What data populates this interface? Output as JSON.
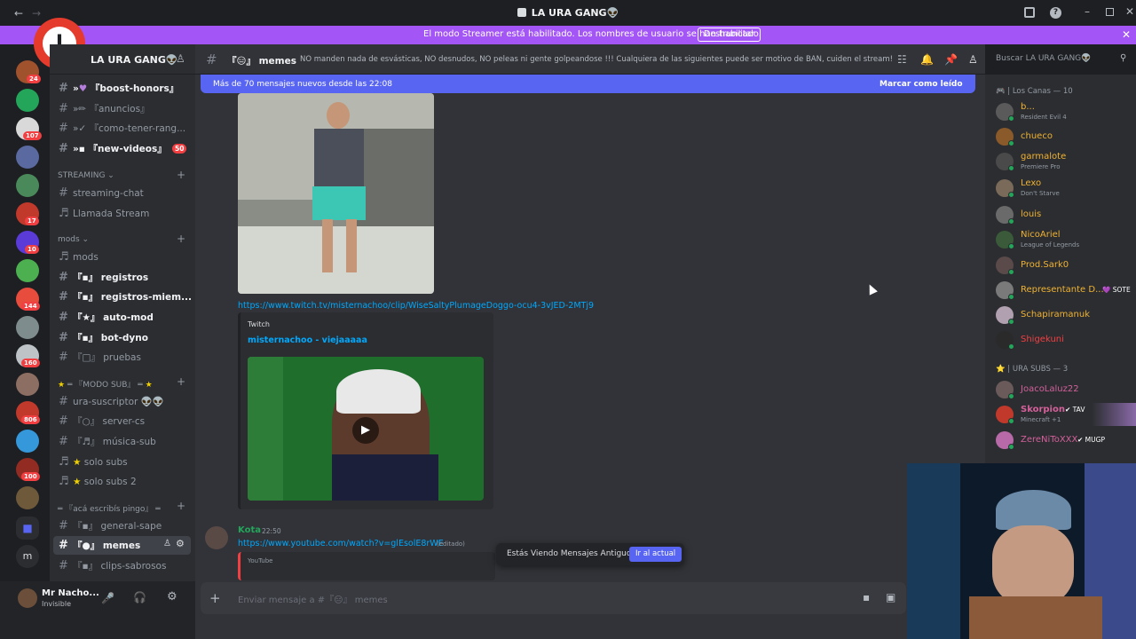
{
  "window": {
    "title": "LA URA GANG👽"
  },
  "streamer_bar": {
    "message": "El modo Streamer está habilitado. Los nombres de usuario se han truncado.",
    "button": "Deshabilitar"
  },
  "server": {
    "name": "LA URA GANG👽",
    "badges": [
      "24",
      "107",
      "17",
      "10",
      "144",
      "160",
      "806",
      "100"
    ]
  },
  "channels": {
    "top": [
      "『boost-honors』",
      "『anuncios』",
      "『como-tener-rang...",
      "『new-videos』"
    ],
    "new_videos_badge": "50",
    "streaming_cat": "STREAMING",
    "streaming": [
      "streaming-chat",
      "Llamada Stream"
    ],
    "mods_cat": "mods",
    "mods": [
      "mods",
      "registros",
      "registros-miem...",
      "auto-mod",
      "bot-dyno",
      "pruebas"
    ],
    "modo_sub_cat": "═ 『MODO SUB』 ═",
    "modo_sub": [
      "ura-suscriptor 👽👽",
      "server-cs",
      "música-sub",
      "solo subs",
      "solo subs 2"
    ],
    "escribis_cat": "═ 『acá escribís pingo』 ═",
    "escribis": [
      "general-sape",
      "memes",
      "clips-sabrosos"
    ]
  },
  "user": {
    "name": "Mr Nacho...",
    "status": "Invisible"
  },
  "header": {
    "channel": "『😑』 memes",
    "topic": "NO manden nada de esvásticas, NO desnudos, NO peleas ni gente golpeandose !!! Cualquiera de las siguientes puede ser motivo de BAN, cuiden el stream!",
    "search_placeholder": "Buscar LA URA GANG👽"
  },
  "new_messages": {
    "text": "Más de 70 mensajes nuevos desde las 22:08",
    "mark": "Marcar como leído"
  },
  "messages": {
    "link1": "https://www.twitch.tv/misternachoo/clip/WiseSaltyPlumageDoggo-ocu4-3vJED-2MTj9",
    "embed_provider": "Twitch",
    "embed_title": "misternachoo - viejaaaaa",
    "author2": "Kota",
    "time2": "22:50",
    "link2": "https://www.youtube.com/watch?v=glEsolE8rWE",
    "edited": "(editado)",
    "embed2_provider": "YouTube"
  },
  "old_messages": {
    "text": "Estás Viendo Mensajes Antiguos",
    "button": "Ir al actual"
  },
  "composer": {
    "placeholder": "Enviar mensaje a #『😑』 memes"
  },
  "members": {
    "group1": "🎮 | Los Canas — 10",
    "list1": [
      {
        "name": "b...",
        "activity": "Resident Evil 4",
        "color": "#f2f3f5"
      },
      {
        "name": "chueco",
        "activity": "",
        "color": "#f0b232"
      },
      {
        "name": "garmalote",
        "activity": "Premiere Pro",
        "color": "#f0b232"
      },
      {
        "name": "Lexo",
        "activity": "Don't Starve",
        "color": "#f0b232"
      },
      {
        "name": "louis",
        "activity": "",
        "color": "#f0b232"
      },
      {
        "name": "NicoAriel",
        "activity": "League of Legends",
        "color": "#f0b232"
      },
      {
        "name": "Prod.Sark0",
        "activity": "",
        "color": "#f0b232"
      },
      {
        "name": "Representante D...",
        "activity": "",
        "color": "#f0b232",
        "tag": "💜 SOTE"
      },
      {
        "name": "Schapiramanuk",
        "activity": "",
        "color": "#f0b232"
      },
      {
        "name": "Shigekuni",
        "activity": "",
        "color": "#f23f42"
      }
    ],
    "group2": "⭐ | URA SUBS — 3",
    "list2": [
      {
        "name": "JoacoLaluz22",
        "activity": "",
        "color": "#d4609a"
      },
      {
        "name": "Skorpion",
        "activity": "Minecraft +1",
        "color": "#d4609a",
        "tag": "✔ TAV"
      },
      {
        "name": "ZereNiToXXX",
        "activity": "",
        "color": "#d4609a",
        "tag": "✔ MUGP"
      }
    ]
  },
  "colors": {
    "accent": "#5865f2",
    "streamer": "#a355f5",
    "link": "#00a8fc"
  }
}
